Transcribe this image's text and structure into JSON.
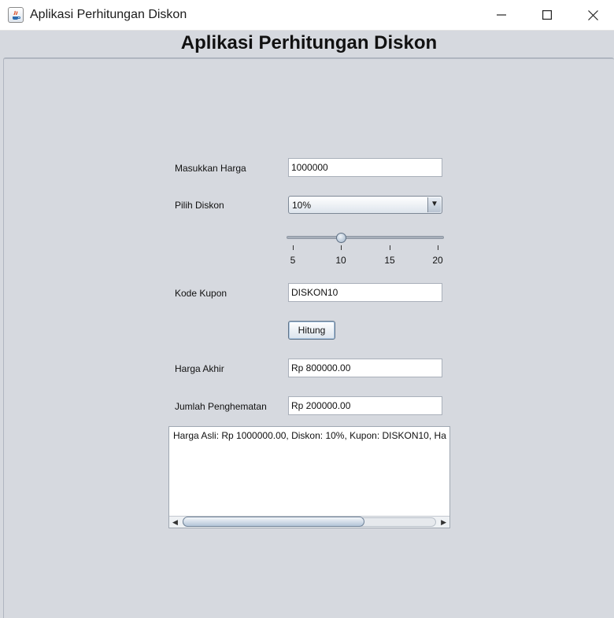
{
  "window": {
    "title": "Aplikasi Perhitungan Diskon"
  },
  "app": {
    "heading": "Aplikasi Perhitungan Diskon"
  },
  "form": {
    "harga_label": "Masukkan Harga",
    "harga_value": "1000000",
    "diskon_label": "Pilih Diskon",
    "diskon_selected": "10%",
    "slider": {
      "value": 10,
      "min": 5,
      "max": 20,
      "ticks": [
        "5",
        "10",
        "15",
        "20"
      ]
    },
    "kupon_label": "Kode Kupon",
    "kupon_value": "DISKON10",
    "hitung_label": "Hitung",
    "akhir_label": "Harga Akhir",
    "akhir_value": "Rp 800000.00",
    "hemat_label": "Jumlah Penghematan",
    "hemat_value": "Rp 200000.00"
  },
  "output": {
    "text": "Harga Asli: Rp 1000000.00, Diskon: 10%, Kupon: DISKON10, Ha"
  },
  "icons": {
    "app": "java-app-icon",
    "minimize": "minimize-icon",
    "maximize": "maximize-icon",
    "close": "close-icon",
    "dropdown": "chevron-down-icon",
    "scroll_left": "arrow-left-icon",
    "scroll_right": "arrow-right-icon"
  }
}
